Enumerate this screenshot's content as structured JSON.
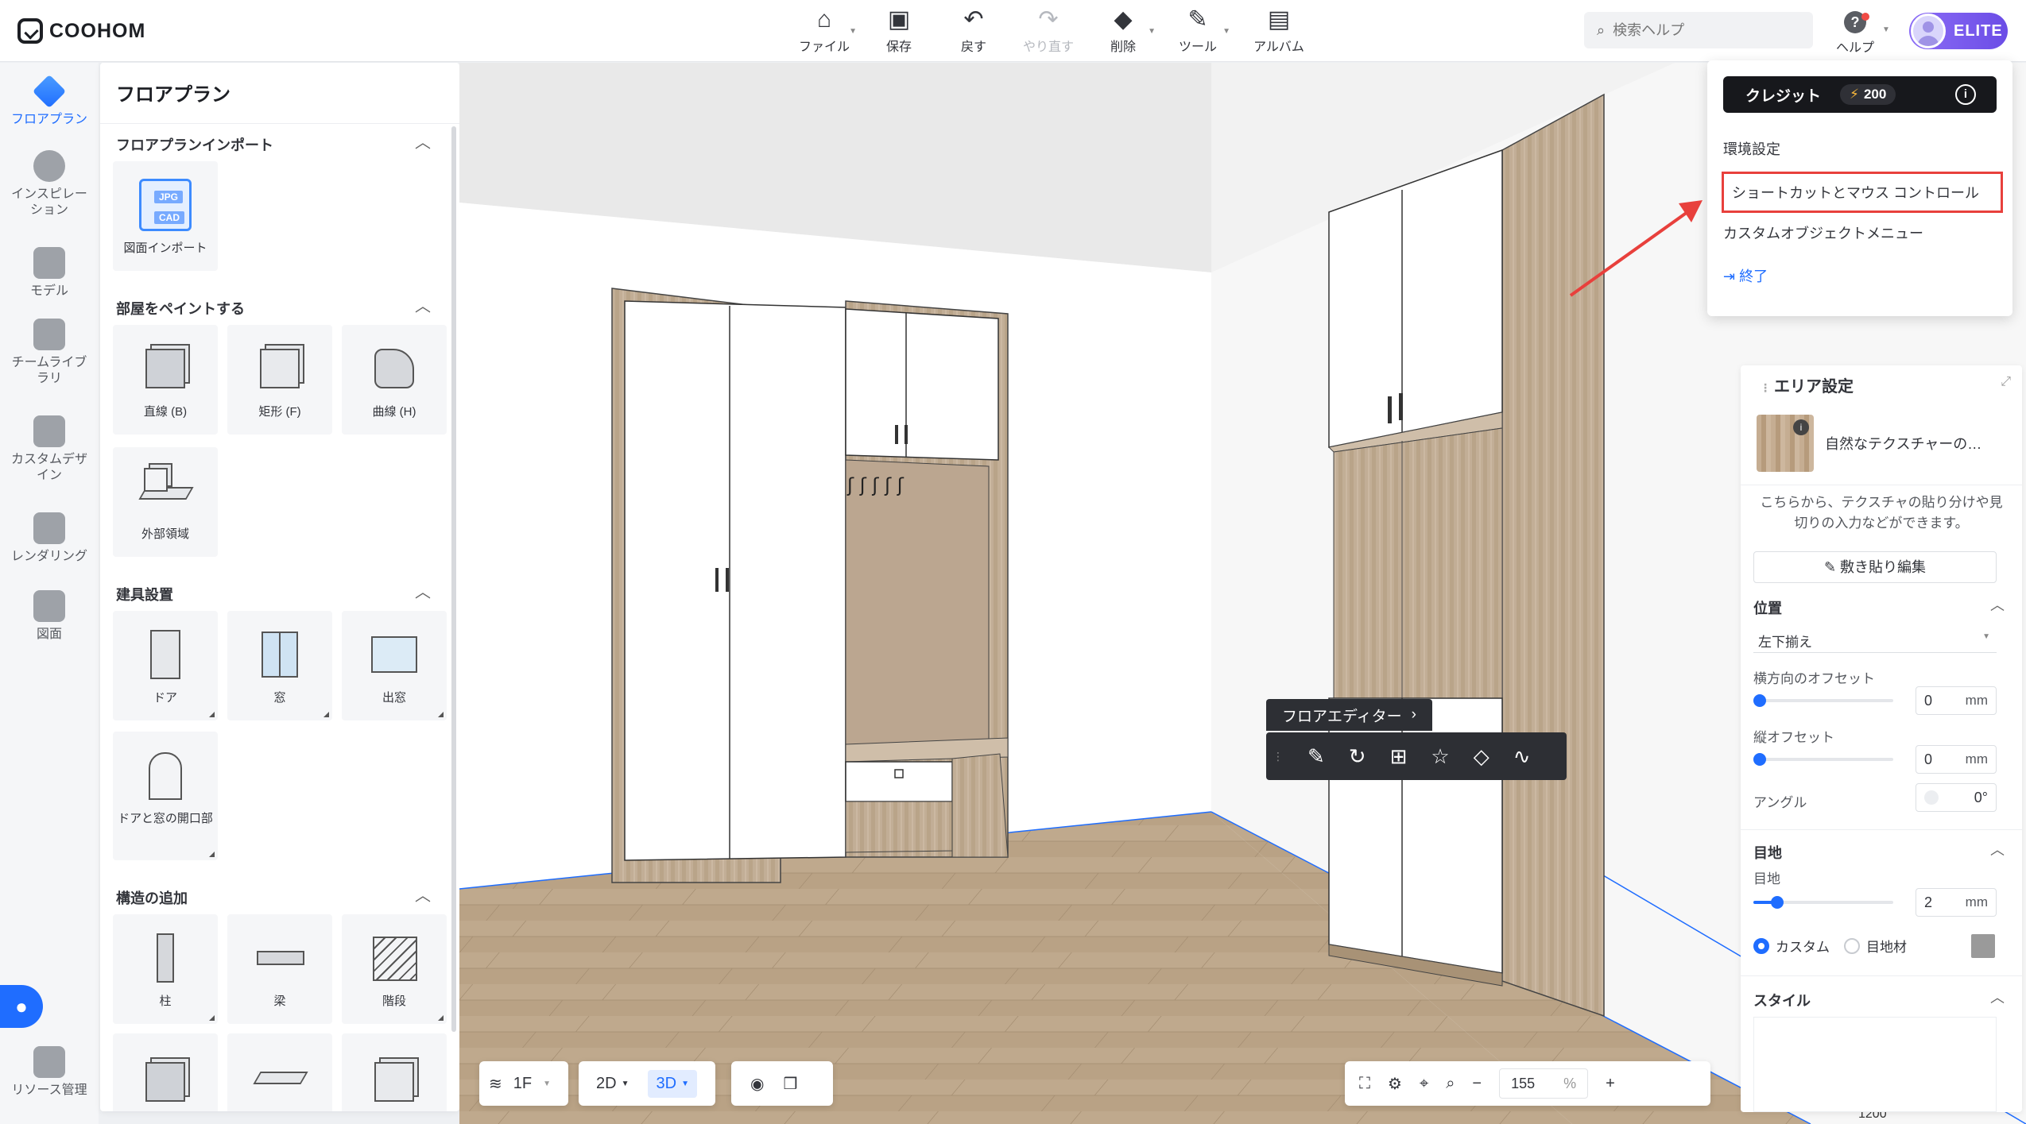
{
  "app": {
    "logo_text": "COOHOM"
  },
  "toolbar": {
    "items": [
      {
        "label": "ファイル",
        "icon": "home-icon"
      },
      {
        "label": "保存",
        "icon": "save-icon"
      },
      {
        "label": "戻す",
        "icon": "undo-icon"
      },
      {
        "label": "やり直す",
        "icon": "redo-icon"
      },
      {
        "label": "削除",
        "icon": "eraser-icon"
      },
      {
        "label": "ツール",
        "icon": "wrench-icon"
      },
      {
        "label": "アルバム",
        "icon": "album-icon"
      }
    ]
  },
  "search": {
    "placeholder": "検索ヘルプ"
  },
  "help": {
    "label": "ヘルプ"
  },
  "user": {
    "badge": "ELITE"
  },
  "leftnav": {
    "items": [
      {
        "label": "フロアプラン",
        "active": true
      },
      {
        "label": "インスピレーション"
      },
      {
        "label": "モデル"
      },
      {
        "label": "チームライブラリ"
      },
      {
        "label": "カスタムデザイン"
      },
      {
        "label": "レンダリング"
      },
      {
        "label": "図面"
      },
      {
        "label": "リソース管理"
      }
    ]
  },
  "panel": {
    "title": "フロアプラン",
    "sections": {
      "import": {
        "title": "フロアプランインポート",
        "items": [
          "図面インポート"
        ],
        "badge_jpg": "JPG",
        "badge_cad": "CAD"
      },
      "paint": {
        "title": "部屋をペイントする",
        "items": [
          "直線 (B)",
          "矩形 (F)",
          "曲線 (H)",
          "外部領域"
        ]
      },
      "fixtures": {
        "title": "建具設置",
        "items": [
          "ドア",
          "窓",
          "出窓",
          "ドアと窓の開口部"
        ]
      },
      "structure": {
        "title": "構造の追加",
        "items": [
          "柱",
          "梁",
          "階段"
        ]
      }
    }
  },
  "viewport": {
    "floor_label": "1F",
    "view_2d": "2D",
    "view_3d": "3D",
    "zoom_value": "155",
    "zoom_unit": "%",
    "floor_editor_label": "フロアエディター",
    "dimension_label": "1200"
  },
  "menu": {
    "credit_label": "クレジット",
    "credit_value": "200",
    "items": [
      "環境設定",
      "ショートカットとマウス コントロール",
      "カスタムオブジェクトメニュー"
    ],
    "exit": "終了",
    "highlight_color": "#e8403c"
  },
  "area_settings": {
    "title": "エリア設定",
    "material_name": "自然なテクスチャーの…",
    "description": "こちらから、テクスチャの貼り分けや見切りの入力などができます。",
    "edit_button": "敷き貼り編集",
    "position": {
      "title": "位置",
      "alignment": "左下揃え",
      "h_offset_label": "横方向のオフセット",
      "h_offset": "0",
      "v_offset_label": "縦オフセット",
      "v_offset": "0",
      "unit": "mm",
      "angle_label": "アングル",
      "angle": "0°"
    },
    "joint": {
      "title": "目地",
      "label": "目地",
      "value": "2",
      "unit": "mm",
      "option_custom": "カスタム",
      "option_material": "目地材"
    },
    "style": {
      "title": "スタイル"
    }
  },
  "colors": {
    "accent": "#1f6dff",
    "dark": "#2d2f34",
    "wood": "#b8a288"
  }
}
